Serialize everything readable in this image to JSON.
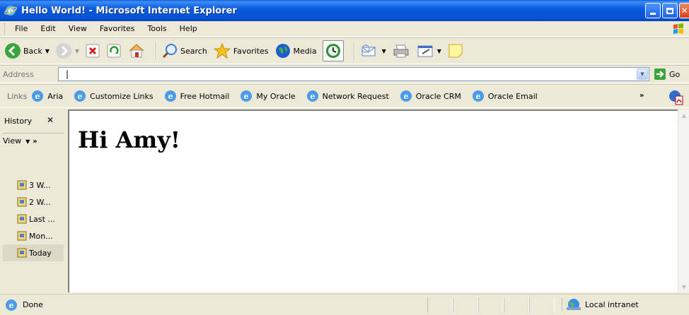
{
  "window": {
    "title": "Hello World! - Microsoft Internet Explorer"
  },
  "menu": {
    "items": [
      "File",
      "Edit",
      "View",
      "Favorites",
      "Tools",
      "Help"
    ]
  },
  "toolbar": {
    "back_label": "Back",
    "search_label": "Search",
    "favorites_label": "Favorites",
    "media_label": "Media"
  },
  "address": {
    "label": "Address",
    "value": "|",
    "go_label": "Go"
  },
  "links": {
    "label": "Links",
    "items": [
      "Aria",
      "Customize Links",
      "Free Hotmail",
      "My Oracle",
      "Network Request",
      "Oracle CRM",
      "Oracle Email"
    ]
  },
  "history": {
    "title": "History",
    "view_label": "View",
    "items": [
      "3 W...",
      "2 W...",
      "Last ...",
      "Mon...",
      "Today"
    ],
    "selected": "Today"
  },
  "content": {
    "heading": "Hi Amy!"
  },
  "status": {
    "text": "Done",
    "zone": "Local intranet"
  },
  "colors": {
    "titlebar": "#0653d4",
    "chrome": "#ece9d8",
    "content": "#ffffff"
  }
}
